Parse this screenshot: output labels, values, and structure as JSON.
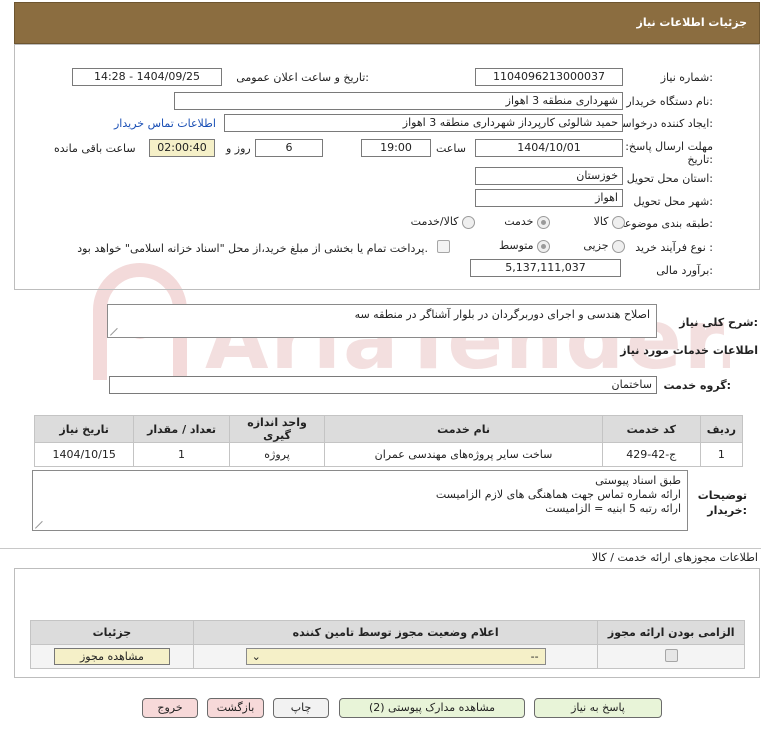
{
  "header": {
    "title": "جزئیات اطلاعات نیاز"
  },
  "watermark": "AriaTender.neT",
  "labels": {
    "need_number": "شماره نیاز:",
    "announce_datetime": "تاریخ و ساعت اعلان عمومی:",
    "buyer_org": "نام دستگاه خریدار:",
    "requester": "ایجاد کننده درخواست:",
    "buyer_contact": "اطلاعات تماس خریدار",
    "deadline": "مهلت ارسال پاسخ: تا تاریخ:",
    "time_word": "ساعت",
    "day_word": "روز و",
    "remaining": "ساعت باقی مانده",
    "province": "استان محل تحویل:",
    "city": "شهر محل تحویل:",
    "category": "طبقه بندی موضوعی:",
    "purchase_type": "نوع فرآیند خرید :",
    "estimate": "برآورد مالی:",
    "summary": "شرح کلی نیاز:",
    "services_info": "اطلاعات خدمات مورد نیاز",
    "service_group": "گروه خدمت:",
    "buyer_notes": "توضیحات خریدار:",
    "permits_title": "اطلاعات مجوزهای ارائه خدمت / کالا"
  },
  "values": {
    "need_number": "1104096213000037",
    "announce_datetime": "1404/09/25 - 14:28",
    "buyer_org": "شهرداری منطقه 3 اهواز",
    "requester": "حمید شالوئی کارپرداز شهرداری منطقه 3 اهواز",
    "deadline_date": "1404/10/01",
    "deadline_time": "19:00",
    "days": "6",
    "remaining_time": "02:00:40",
    "province": "خوزستان",
    "city": "اهواز",
    "estimate": "5,137,111,037",
    "summary": "اصلاح هندسی و اجرای دوربرگردان در بلوار آشناگر در منطقه سه",
    "service_group": "ساختمان"
  },
  "category_options": [
    {
      "label": "کالا",
      "selected": false
    },
    {
      "label": "خدمت",
      "selected": true
    },
    {
      "label": "کالا/خدمت",
      "selected": false
    }
  ],
  "purchase_options": [
    {
      "label": "جزیی",
      "selected": false
    },
    {
      "label": "متوسط",
      "selected": true
    }
  ],
  "payment_note": "پرداخت تمام یا بخشی از مبلغ خرید،از محل \"اسناد خزانه اسلامی\" خواهد بود.",
  "services_table": {
    "headers": [
      "ردیف",
      "کد خدمت",
      "نام خدمت",
      "واحد اندازه گیری",
      "تعداد / مقدار",
      "تاریخ نیاز"
    ],
    "rows": [
      [
        "1",
        "ج-42-429",
        "ساخت سایر پروژه‌های مهندسی عمران",
        "پروژه",
        "1",
        "1404/10/15"
      ]
    ]
  },
  "notes_lines": [
    "طبق اسناد پیوستی",
    "ارائه شماره تماس جهت هماهنگی های لازم الزامیست",
    "ارائه رتبه 5 ابنیه = الزامیست"
  ],
  "permits_table": {
    "headers": [
      "الزامی بودن ارائه مجوز",
      "اعلام وضعیت مجوز توسط تامین کننده",
      "جزئیات"
    ],
    "status_value": "--",
    "view_button": "مشاهده مجوز"
  },
  "buttons": {
    "reply": "پاسخ به نیاز",
    "attachments": "مشاهده مدارک پیوستی (2)",
    "print": "چاپ",
    "back": "بازگشت",
    "exit": "خروج"
  }
}
